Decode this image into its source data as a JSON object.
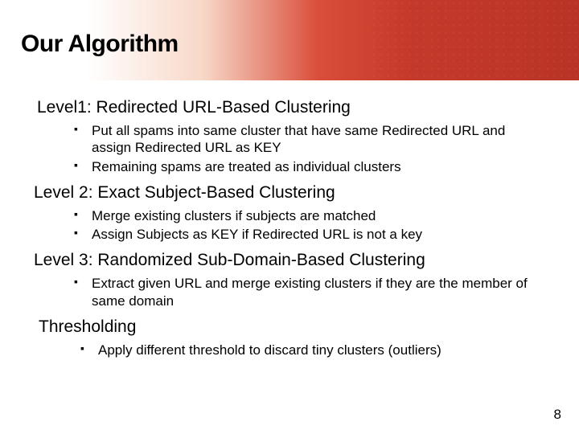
{
  "header": {
    "title": "Our Algorithm"
  },
  "sections": [
    {
      "heading": "Level1: Redirected URL-Based Clustering",
      "bullets": [
        "Put all spams into same cluster that have same Redirected URL and assign Redirected URL as KEY",
        "Remaining spams are treated as individual clusters"
      ]
    },
    {
      "heading": "Level 2: Exact Subject-Based Clustering",
      "bullets": [
        "Merge existing clusters if subjects are matched",
        "Assign Subjects as KEY if Redirected URL is not a key"
      ]
    },
    {
      "heading": "Level 3: Randomized Sub-Domain-Based Clustering",
      "bullets": [
        "Extract given URL and merge existing clusters if they are the member of same domain"
      ]
    },
    {
      "heading": "Thresholding",
      "bullets": [
        "Apply different threshold to discard tiny clusters (outliers)"
      ]
    }
  ],
  "page_number": "8"
}
